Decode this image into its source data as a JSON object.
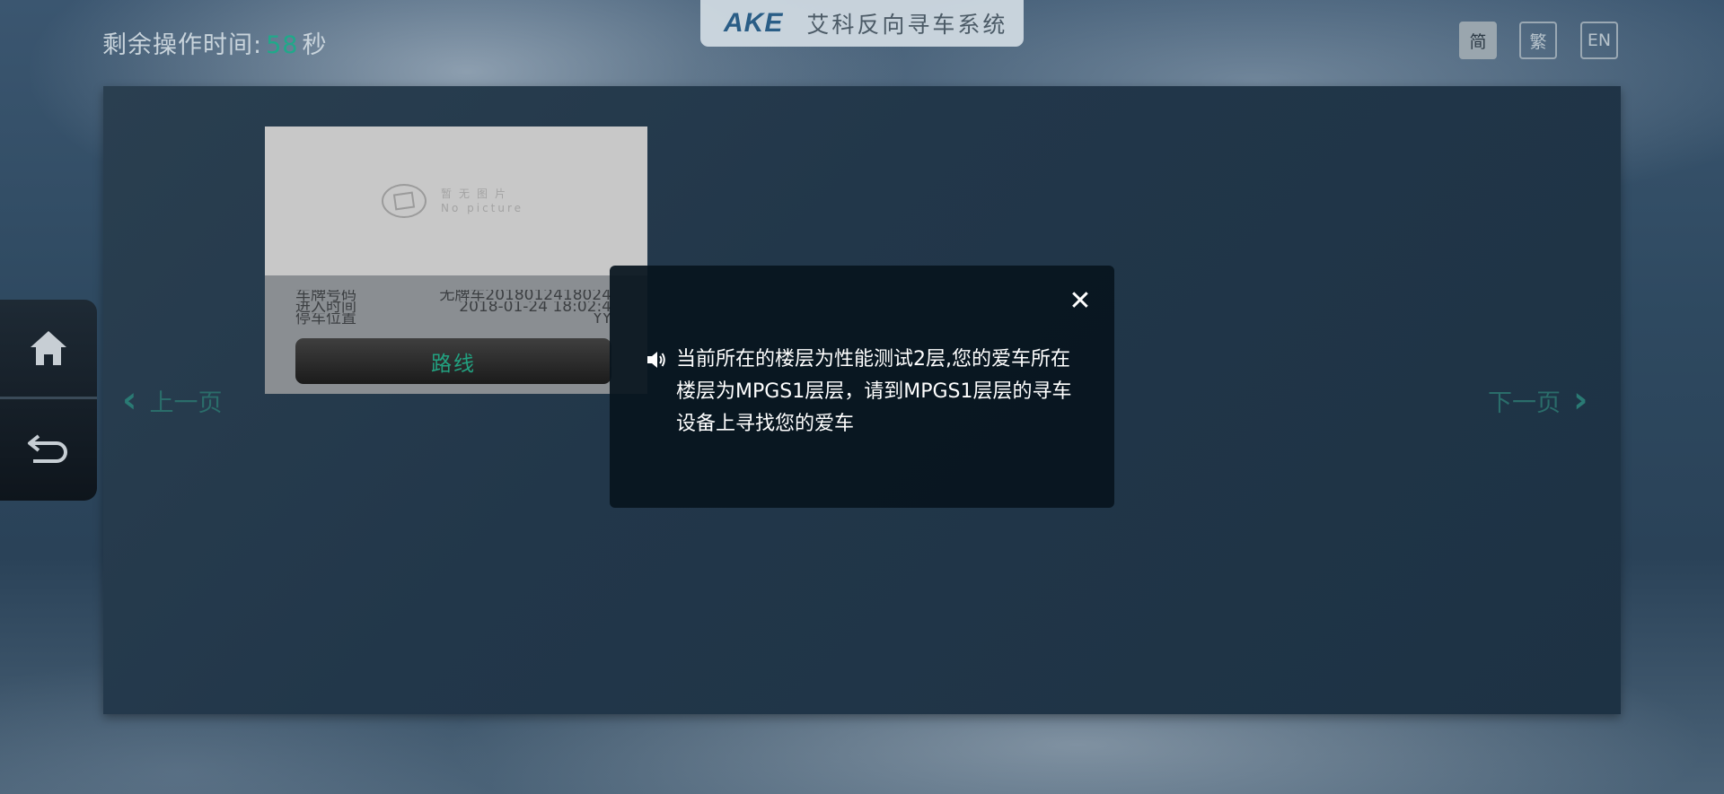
{
  "header": {
    "timer_label": "剩余操作时间:",
    "timer_seconds": "58",
    "timer_unit": "秒",
    "brand_logo": "AKE",
    "brand_name": "艾科反向寻车系统",
    "languages": [
      "简",
      "繁",
      "EN"
    ],
    "active_language": "简"
  },
  "card": {
    "photo_placeholder_cn": "暂无图片",
    "photo_placeholder_en": "No picture",
    "rows": [
      {
        "label": "车牌号码",
        "value": "无牌车2018012418024"
      },
      {
        "label": "进入时间",
        "value": "2018-01-24 18:02:4"
      },
      {
        "label": "停车位置",
        "value": "YY"
      }
    ],
    "route_button": "路线"
  },
  "pager": {
    "prev_label": "上一页",
    "next_label": "下一页"
  },
  "dialog": {
    "close_symbol": "✕",
    "message": "当前所在的楼层为性能测试2层,您的爱车所在楼层为MPGS1层层，请到MPGS1层层的寻车设备上寻找您的爱车"
  },
  "colors": {
    "accent": "#20a98a",
    "panel": "#22374a",
    "dialog": "#08141e"
  },
  "icons": [
    "home-icon",
    "back-icon",
    "speaker-icon",
    "close-icon",
    "chevron-left-icon",
    "chevron-right-icon",
    "no-picture-icon"
  ]
}
